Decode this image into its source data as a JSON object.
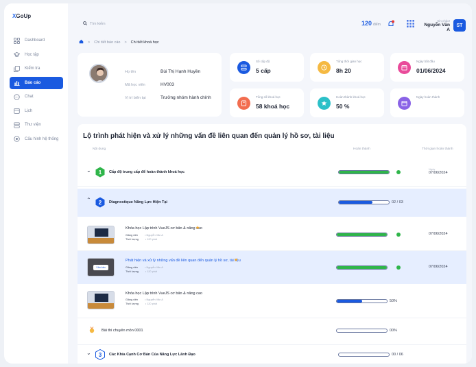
{
  "app": {
    "logo_mark": "X",
    "logo_text": "GoUp"
  },
  "sidebar": {
    "items": [
      {
        "label": "Dashboard",
        "icon": "dashboard-icon",
        "active": false
      },
      {
        "label": "Học tập",
        "icon": "graduation-cap-icon",
        "active": false
      },
      {
        "label": "Kiểm tra",
        "icon": "exam-icon",
        "active": false
      },
      {
        "label": "Báo cáo",
        "icon": "chart-icon",
        "active": true
      },
      {
        "label": "Chat",
        "icon": "chat-icon",
        "active": false
      },
      {
        "label": "Lịch",
        "icon": "calendar-icon",
        "active": false
      },
      {
        "label": "Thư viện",
        "icon": "library-icon",
        "active": false
      },
      {
        "label": "Cấu hình hệ thống",
        "icon": "settings-icon",
        "active": false
      }
    ]
  },
  "topbar": {
    "search_placeholder": "Tìm kiếm",
    "points_value": "120",
    "points_unit": "điểm",
    "greeting": "Xin chào!",
    "user_name": "Nguyễn Văn A",
    "avatar_initials": "ST"
  },
  "breadcrumb": {
    "parent": "Chi tiết báo cáo",
    "current": "Chi tiết khoá học"
  },
  "profile": {
    "name_label": "Họ tên",
    "name_value": "Bùi Thị Hạnh Huyền",
    "code_label": "Mã học viên",
    "code_value": "HV003",
    "role_label": "Vị trí biên tại",
    "role_value": "Trưởng nhóm hành chính"
  },
  "stats": [
    {
      "label": "Số cấp độ",
      "value": "5 cấp",
      "color": "#1a5ae0",
      "icon": "layers-icon"
    },
    {
      "label": "Tổng thời gian học",
      "value": "8h 20",
      "color": "#f5b942",
      "icon": "clock-icon"
    },
    {
      "label": "Ngày bắt đầu",
      "value": "01/06/2024",
      "color": "#e94b9a",
      "icon": "calendar-start-icon"
    },
    {
      "label": "Tổng số khoá học",
      "value": "58 khoá học",
      "color": "#f26d4f",
      "icon": "book-icon"
    },
    {
      "label": "Hoàn thành khoá học",
      "value": "50 %",
      "color": "#2cc0c8",
      "icon": "star-badge-icon"
    },
    {
      "label": "Ngày hoàn thành",
      "value": "",
      "color": "#8a63e6",
      "icon": "calendar-end-icon"
    }
  ],
  "roadmap": {
    "title": "Lộ trình phát hiện và xử lý những vấn đề liên quan đến quản lý hồ sơ, tài liệu",
    "col_content": "Nội dung",
    "col_completion": "Hoàn thành",
    "col_time": "Thời gian hoàn thành",
    "sections": [
      {
        "number": "1",
        "title": "Cấp độ trung cấp để hoàn thành khoá học",
        "progress": 1.0,
        "date_label": "Ngày",
        "date": "07/06/2024",
        "color": "#2fb54a"
      },
      {
        "number": "2",
        "title": "Diagnostique Năng Lực Hiện Tại",
        "progress": 0.67,
        "progress_text": "02 / 03",
        "color": "#1a5ae0"
      },
      {
        "number": "3",
        "title": "Các Khía Cạnh Cơ Bản Của Năng Lực Lãnh Đạo",
        "progress": 0,
        "progress_text": "00 / 06",
        "color": "#1a5ae0"
      }
    ],
    "courses": [
      {
        "title": "Khóa học Lập trình VueJS cơ bản & nâng cao",
        "teacher_label": "Giảng viên",
        "teacher": "Nguyễn Văn A",
        "duration_label": "Thời lượng",
        "duration": "120 phút",
        "progress": 1.0,
        "date": "07/06/2024",
        "starred": true
      },
      {
        "title": "Phát hiện và xử lý những vấn đề liên quan đến quản lý hồ sơ, tài liệu",
        "teacher_label": "Giảng viên",
        "teacher": "Nguyễn Văn A",
        "duration_label": "Thời lượng",
        "duration": "120 phút",
        "progress": 1.0,
        "date": "07/06/2024",
        "starred": true,
        "thumb_tag": "Văn bản"
      },
      {
        "title": "Khóa học Lập trình VueJS cơ bản & nâng cao",
        "teacher_label": "Giảng viên",
        "teacher": "Nguyễn Văn A",
        "duration_label": "Thời lượng",
        "duration": "120 phút",
        "progress": 0.5,
        "progress_text": "50%"
      }
    ],
    "exam": {
      "title": "Bài thi chuyên môn 0001",
      "progress": 0,
      "progress_text": "00%"
    }
  }
}
